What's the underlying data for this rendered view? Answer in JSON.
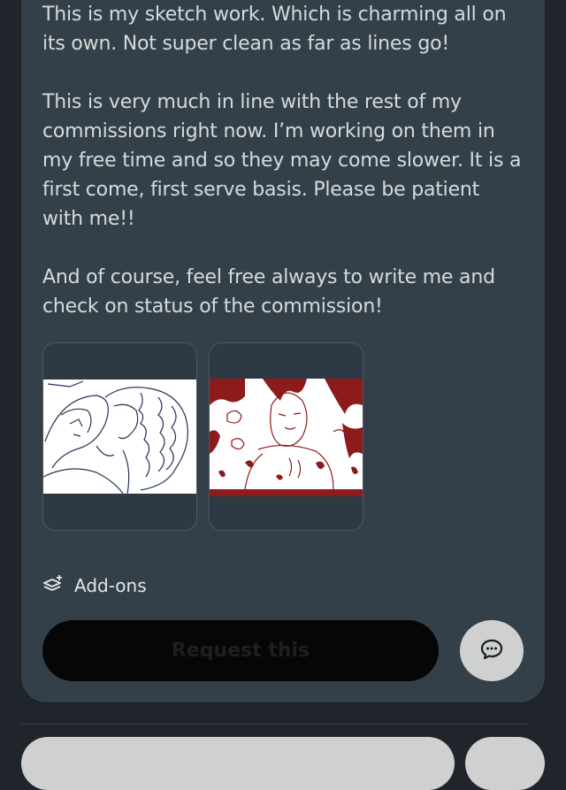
{
  "description": {
    "paragraphs": [
      "This is my sketch work. Which is charming all on its own. Not super clean as far as lines go!",
      "This is very much in line with the rest of my commissions right now. I’m working on them in my free time and so they may come slower. It is a first come, first serve basis. Please be patient with me!!",
      "And of course, feel free always to write me and check on status of the commission!"
    ]
  },
  "addons": {
    "label": "Add-ons",
    "icon": "layers-plus-icon"
  },
  "actions": {
    "request_label": "Request this",
    "message_icon": "chat-bubble-icon"
  },
  "colors": {
    "card": "#344049",
    "page": "#1f252a",
    "text": "#d6dadc",
    "request_button": "#060606",
    "chat_button": "#cfd0d0",
    "sketch_red": "#8e1b1b"
  }
}
